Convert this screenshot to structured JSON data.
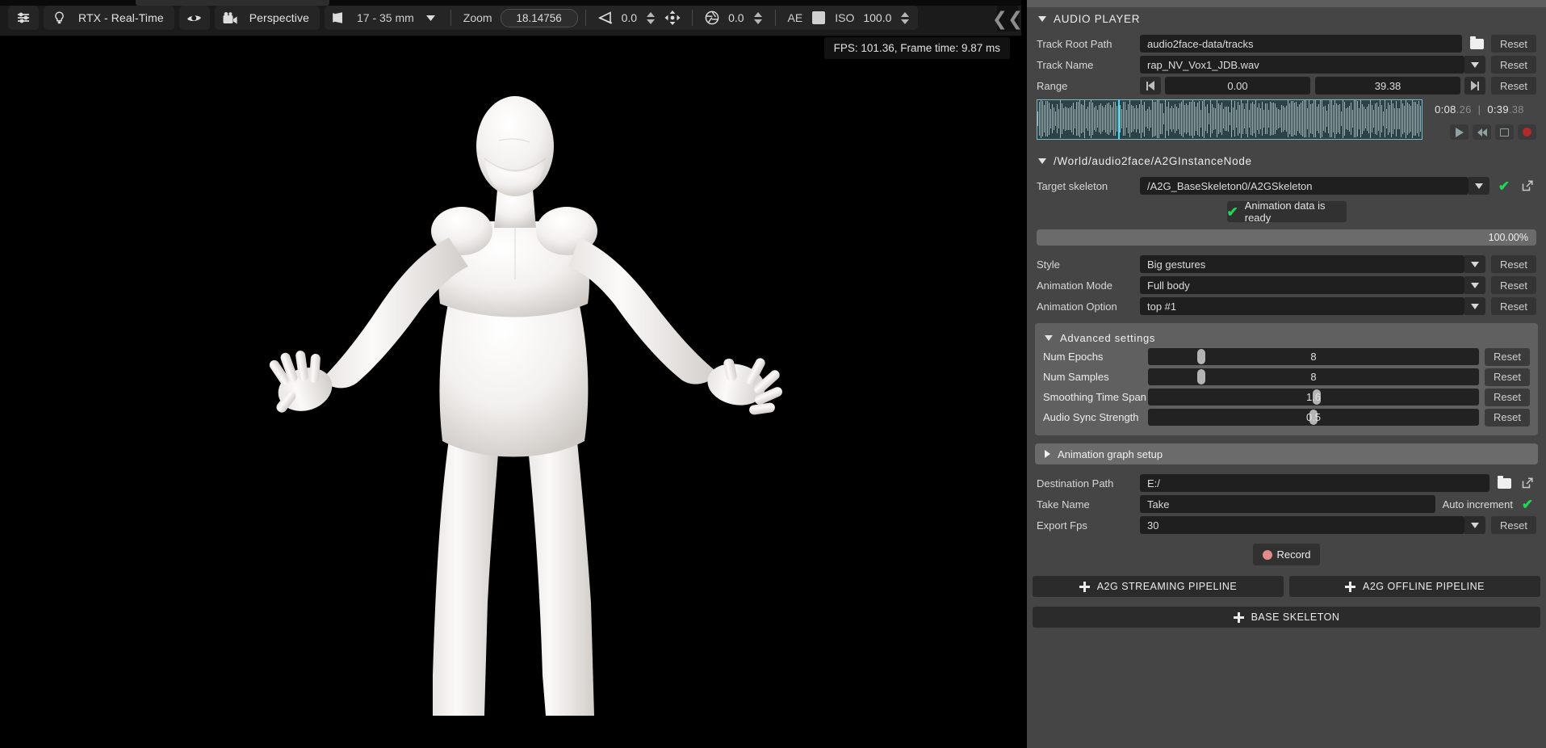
{
  "toolbar": {
    "settings_icon": "sliders-icon",
    "render_mode_icon": "lightbulb-icon",
    "render_mode": "RTX - Real-Time",
    "visibility_icon": "eye-icon",
    "camera_icon": "camera-icon",
    "camera": "Perspective",
    "lens_icon": "lens-icon",
    "lens": "17 - 35 mm",
    "zoom_label": "Zoom",
    "zoom_value": "18.14756",
    "focal_icon": "fov-icon",
    "focal_value": "0.0",
    "move_icon": "move-gizmo-icon",
    "aperture_icon": "aperture-icon",
    "aperture_value": "0.0",
    "ae_label": "AE",
    "iso_label": "ISO",
    "iso_value": "100.0",
    "collapse_icon": "collapse-left-icon"
  },
  "viewport": {
    "fps_overlay": "FPS: 101.36, Frame time: 9.87 ms",
    "character": "humanoid-avatar"
  },
  "audio_player": {
    "title": "AUDIO PLAYER",
    "track_root_path": {
      "label": "Track Root Path",
      "value": "audio2face-data/tracks",
      "browse_icon": "folder-icon",
      "reset": "Reset"
    },
    "track_name": {
      "label": "Track Name",
      "value": "rap_NV_Vox1_JDB.wav",
      "reset": "Reset"
    },
    "range": {
      "label": "Range",
      "start": "0.00",
      "end": "39.38",
      "reset": "Reset",
      "start_icon": "skip-to-start-icon",
      "end_icon": "skip-to-end-icon"
    },
    "time_current": "0:08",
    "time_current_frac": ".26",
    "time_total": "0:39",
    "time_total_frac": ".38",
    "time_separator": "|",
    "transport": [
      {
        "name": "play-button",
        "icon": "play-icon"
      },
      {
        "name": "rewind-button",
        "icon": "rewind-icon"
      },
      {
        "name": "loop-button",
        "icon": "loop-icon"
      },
      {
        "name": "record-button",
        "icon": "record-dot-icon"
      }
    ],
    "playhead_percent": 21
  },
  "instance_node": {
    "title": "/World/audio2face/A2GInstanceNode",
    "target_skeleton": {
      "label": "Target skeleton",
      "value": "/A2G_BaseSkeleton0/A2GSkeleton",
      "check_icon": "check-icon",
      "open_icon": "open-external-icon"
    },
    "status": {
      "text": "Animation data is ready",
      "icon": "check-icon"
    },
    "progress": "100.00%",
    "style": {
      "label": "Style",
      "value": "Big gestures",
      "reset": "Reset"
    },
    "animation_mode": {
      "label": "Animation Mode",
      "value": "Full body",
      "reset": "Reset"
    },
    "animation_option": {
      "label": "Animation Option",
      "value": "top #1",
      "reset": "Reset"
    }
  },
  "advanced_settings": {
    "title": "Advanced settings",
    "sliders": [
      {
        "label": "Num Epochs",
        "value": "8",
        "thumb_percent": 16,
        "reset": "Reset"
      },
      {
        "label": "Num Samples",
        "value": "8",
        "thumb_percent": 16,
        "reset": "Reset"
      },
      {
        "label": "Smoothing Time Span",
        "value": "1.6",
        "thumb_percent": 51,
        "reset": "Reset"
      },
      {
        "label": "Audio Sync Strength",
        "value": "0.5",
        "thumb_percent": 50,
        "reset": "Reset"
      }
    ]
  },
  "animation_graph_setup": {
    "title": "Animation graph setup"
  },
  "export": {
    "destination_path": {
      "label": "Destination Path",
      "value": "E:/",
      "browse_icon": "folder-icon",
      "open_icon": "open-external-icon"
    },
    "take_name": {
      "label": "Take Name",
      "value": "Take",
      "auto_increment_label": "Auto increment",
      "auto_increment_icon": "check-icon"
    },
    "export_fps": {
      "label": "Export Fps",
      "value": "30",
      "reset": "Reset"
    },
    "record_button": "Record"
  },
  "footer": {
    "streaming_pipeline": "A2G STREAMING PIPELINE",
    "offline_pipeline": "A2G OFFLINE PIPELINE",
    "base_skeleton": "BASE SKELETON"
  },
  "colors": {
    "panel_bg": "#454545",
    "field_bg": "#1f1f1f",
    "accent_green": "#1fd655",
    "playhead_cyan": "#3fe3ff",
    "record_red": "#b02b2b",
    "waveform_bg": "#2b4247"
  }
}
